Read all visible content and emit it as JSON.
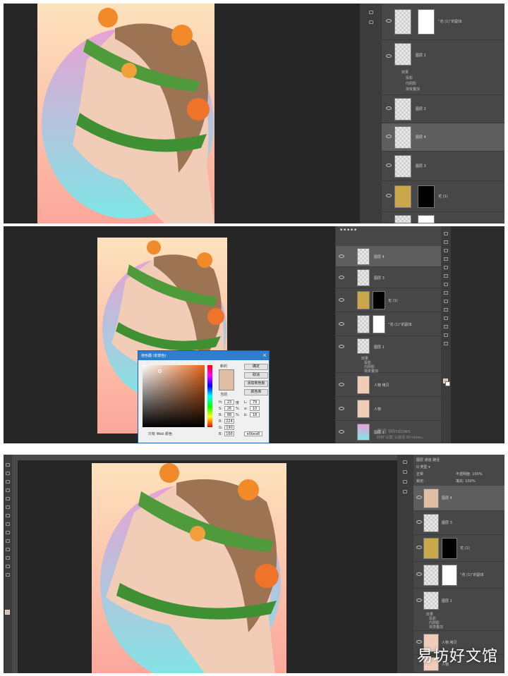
{
  "panel1": {
    "layers": [
      {
        "name": "“花 (1)”的副本",
        "has_mask": true
      },
      {
        "name": "图层 1",
        "effects": [
          "效果",
          "投影",
          "内阴影",
          "渐变叠加"
        ]
      },
      {
        "name": "图层 2"
      },
      {
        "name": "图层 4"
      },
      {
        "name": "图层 3"
      },
      {
        "name": "花 (1)",
        "has_mask": true
      },
      {
        "name": ""
      }
    ]
  },
  "panel2": {
    "layers": [
      {
        "name": "图层 4"
      },
      {
        "name": "图层 3"
      },
      {
        "name": "花 (1)",
        "has_mask": true
      },
      {
        "name": "“花 (1)”的副本",
        "has_mask": true
      },
      {
        "name": "图层 1",
        "effects": [
          "效果",
          "投影",
          "内阴影",
          "渐变叠加"
        ]
      },
      {
        "name": "人物 拷贝"
      },
      {
        "name": "人物"
      },
      {
        "name": "图层 1"
      }
    ],
    "dialog": {
      "title": "拾色器 (前景色)",
      "close": "×",
      "ok": "确定",
      "cancel": "取消",
      "add_swatch": "添加到色板",
      "libraries": "颜色库",
      "new_label": "新的",
      "current_label": "当前",
      "web_only": "只有 Web 颜色",
      "fields": [
        {
          "label": "H:",
          "value": "23",
          "unit": "度"
        },
        {
          "label": "S:",
          "value": "26",
          "unit": "%"
        },
        {
          "label": "B:",
          "value": "88",
          "unit": "%"
        },
        {
          "label": "R:",
          "value": "224"
        },
        {
          "label": "G:",
          "value": "190"
        },
        {
          "label": "B:",
          "value": "166"
        }
      ],
      "lab_fields": [
        {
          "label": "L:",
          "value": "79"
        },
        {
          "label": "a:",
          "value": "10"
        },
        {
          "label": "b:",
          "value": "18"
        }
      ],
      "hex": "e0bea6"
    },
    "windows_watermark": [
      "激活 Windows",
      "转到“设置”以激活 Windows。"
    ]
  },
  "panel3": {
    "options": [
      "正常",
      "不透明度: 100%",
      "锁定:",
      "填充: 100%"
    ],
    "layers": [
      {
        "name": "图层 4"
      },
      {
        "name": "图层 3"
      },
      {
        "name": "花 (1)",
        "has_mask": true
      },
      {
        "name": "“花 (1)”的副本",
        "has_mask": true
      },
      {
        "name": "图层 1",
        "effects": [
          "效果",
          "投影",
          "内阴影",
          "渐变叠加"
        ]
      },
      {
        "name": "人物 拷贝"
      },
      {
        "name": "人物"
      }
    ]
  },
  "watermark": "易坊好文馆",
  "colors": {
    "workspace": "#2b2b2b",
    "panel": "#474747",
    "accent": "#2f7dcf",
    "skin_sample": "#e0bea6",
    "bg_gradient_top": "#fde2bd",
    "bg_gradient_bottom": "#fba79b",
    "oval_top": "#e9a1d3",
    "oval_bottom": "#7fe6e6"
  }
}
